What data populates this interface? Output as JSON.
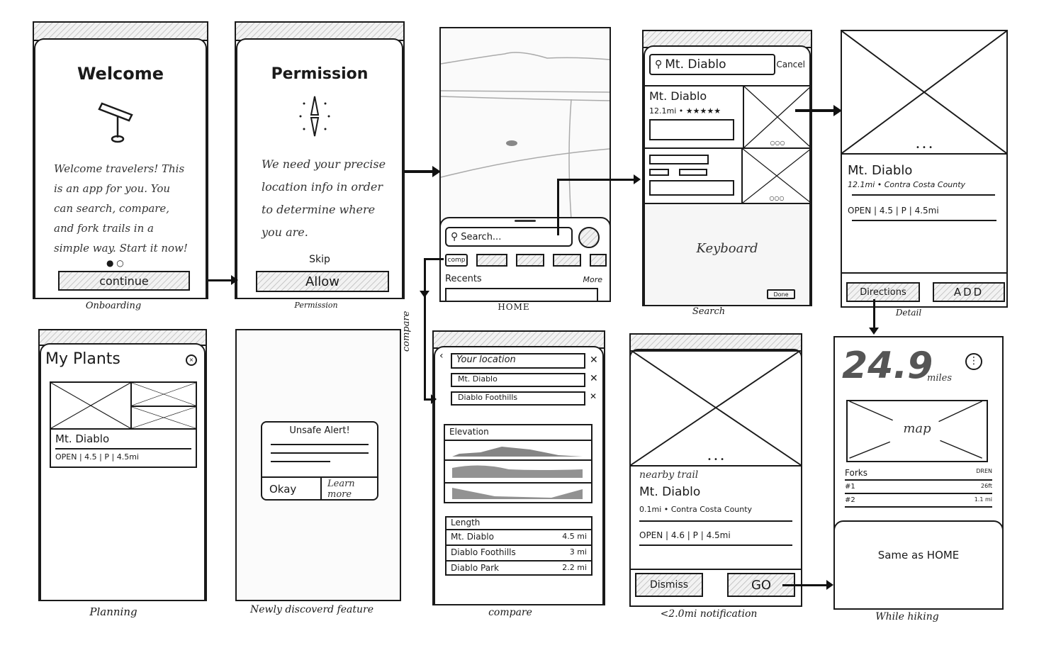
{
  "screens": {
    "onboarding": {
      "caption": "Onboarding",
      "title": "Welcome",
      "icon": "telescope-icon",
      "body": "Welcome travelers! This is an app for you. You can search, compare, and fork trails in a simple way. Start it now!",
      "button": "continue"
    },
    "permission": {
      "caption": "Permission",
      "title": "Permission",
      "icon": "compass-icon",
      "body": "We need your precise location info in order to determine where you are.",
      "skip": "Skip",
      "button": "Allow"
    },
    "home": {
      "caption": "HOME",
      "search_placeholder": "Search...",
      "chips": [
        "comp",
        "",
        "",
        "",
        ""
      ],
      "recents": "Recents",
      "more": "More"
    },
    "search": {
      "caption": "Search",
      "query": "Mt. Diablo",
      "cancel": "Cancel",
      "results": [
        {
          "name": "Mt. Diablo",
          "meta": "12.1mi • ★★★★★"
        },
        {
          "name": "",
          "meta": ""
        }
      ],
      "keyboard": "Keyboard",
      "done": "Done"
    },
    "detail": {
      "caption": "Detail",
      "name": "Mt. Diablo",
      "meta": "12.1mi • Contra Costa County",
      "stats": "OPEN | 4.5 | P | 4.5mi",
      "directions": "Directions",
      "add": "ADD"
    },
    "planning": {
      "caption": "Planning",
      "title": "My Plants",
      "card_name": "Mt. Diablo",
      "card_stats": "OPEN | 4.5 | P | 4.5mi"
    },
    "feature": {
      "caption": "Newly discoverd feature",
      "alert_title": "Unsafe Alert!",
      "okay": "Okay",
      "learn_more": "Learn more"
    },
    "compare": {
      "caption": "compare",
      "side_label": "compare",
      "locations": [
        "Your location",
        "Mt. Diablo",
        "Diablo Foothills"
      ],
      "elevation": "Elevation",
      "length_header": "Length",
      "lengths": [
        {
          "name": "Mt. Diablo",
          "value": "4.5 mi"
        },
        {
          "name": "Diablo Foothills",
          "value": "3 mi"
        },
        {
          "name": "Diablo Park",
          "value": "2.2 mi"
        }
      ]
    },
    "notification": {
      "caption": "<2.0mi notification",
      "label": "nearby trail",
      "name": "Mt. Diablo",
      "meta": "0.1mi • Contra Costa County",
      "stats": "OPEN | 4.6 | P | 4.5mi",
      "dismiss": "Dismiss",
      "go": "GO"
    },
    "hiking": {
      "caption": "While hiking",
      "distance": "24.9",
      "unit": "miles",
      "map": "map",
      "forks_header": "Forks",
      "forks_right": "DREN",
      "forks": [
        {
          "name": "#1",
          "value": "26ft"
        },
        {
          "name": "#2",
          "value": "1.1 mi"
        }
      ],
      "sheet": "Same as HOME"
    }
  }
}
